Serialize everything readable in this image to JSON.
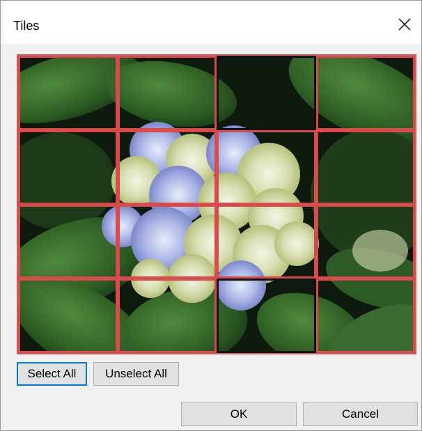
{
  "dialog": {
    "title": "Tiles",
    "close_glyph": "✕"
  },
  "tile_grid": {
    "rows": 4,
    "cols": 4,
    "tiles": [
      {
        "row": 1,
        "col": 1,
        "selected": true
      },
      {
        "row": 1,
        "col": 2,
        "selected": true
      },
      {
        "row": 1,
        "col": 3,
        "selected": false
      },
      {
        "row": 1,
        "col": 4,
        "selected": true
      },
      {
        "row": 2,
        "col": 1,
        "selected": true
      },
      {
        "row": 2,
        "col": 2,
        "selected": true
      },
      {
        "row": 2,
        "col": 3,
        "selected": true
      },
      {
        "row": 2,
        "col": 4,
        "selected": true
      },
      {
        "row": 3,
        "col": 1,
        "selected": true
      },
      {
        "row": 3,
        "col": 2,
        "selected": true
      },
      {
        "row": 3,
        "col": 3,
        "selected": true
      },
      {
        "row": 3,
        "col": 4,
        "selected": true
      },
      {
        "row": 4,
        "col": 1,
        "selected": true
      },
      {
        "row": 4,
        "col": 2,
        "selected": true
      },
      {
        "row": 4,
        "col": 3,
        "selected": false
      },
      {
        "row": 4,
        "col": 4,
        "selected": true
      }
    ],
    "selection_color": "#d94a4a"
  },
  "buttons": {
    "select_all": "Select All",
    "unselect_all": "Unselect All",
    "ok": "OK",
    "cancel": "Cancel"
  },
  "colors": {
    "dialog_bg": "#f0f0f0",
    "focus_border": "#0078d7",
    "button_bg": "#e1e1e1"
  }
}
